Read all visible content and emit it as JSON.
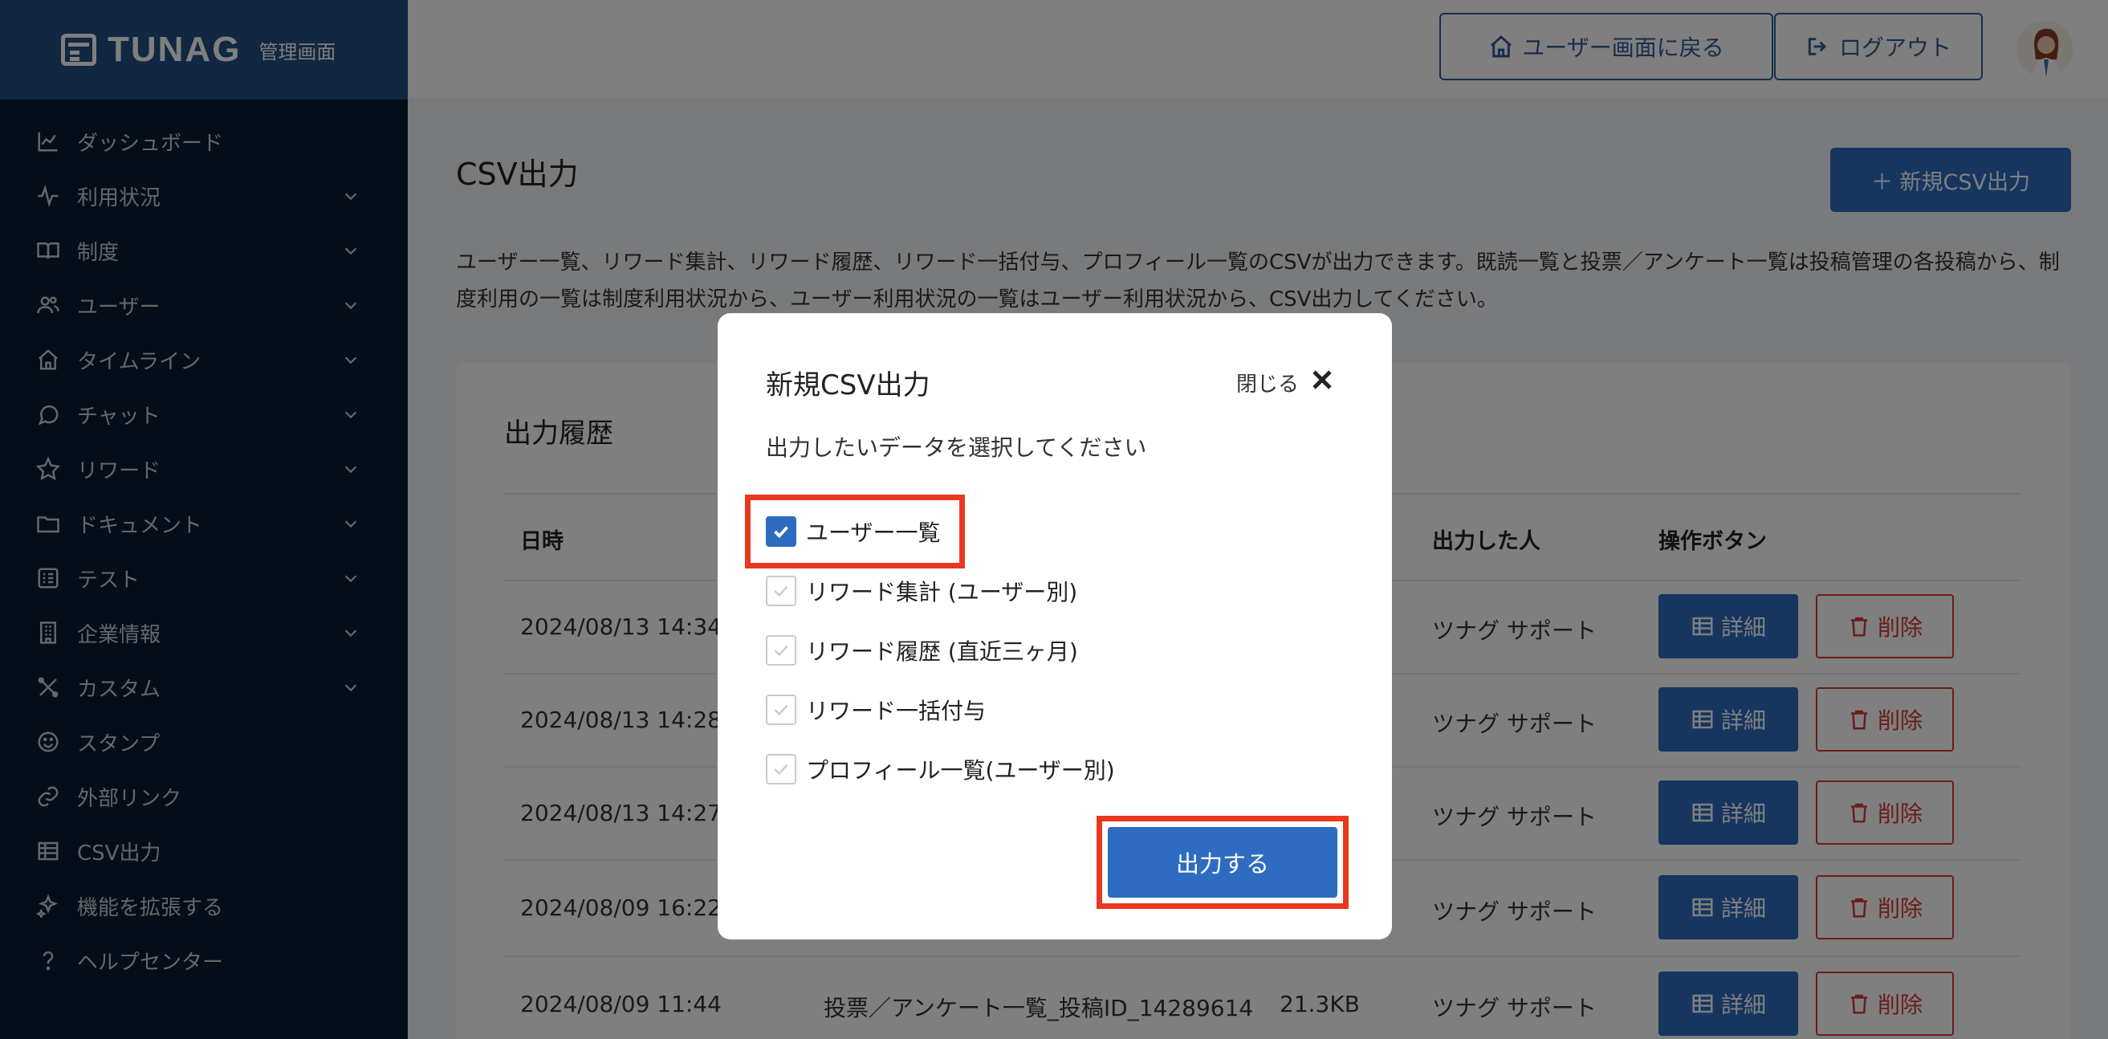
{
  "brand": {
    "name": "TUNAG",
    "sub": "管理画面"
  },
  "sidebar": {
    "items": [
      {
        "label": "ダッシュボード",
        "icon": "chart-line-icon",
        "expandable": false
      },
      {
        "label": "利用状況",
        "icon": "pulse-icon",
        "expandable": true
      },
      {
        "label": "制度",
        "icon": "book-icon",
        "expandable": true
      },
      {
        "label": "ユーザー",
        "icon": "users-icon",
        "expandable": true
      },
      {
        "label": "タイムライン",
        "icon": "home-icon",
        "expandable": true
      },
      {
        "label": "チャット",
        "icon": "chat-bubble-icon",
        "expandable": true
      },
      {
        "label": "リワード",
        "icon": "star-icon",
        "expandable": true
      },
      {
        "label": "ドキュメント",
        "icon": "folder-icon",
        "expandable": true
      },
      {
        "label": "テスト",
        "icon": "checklist-icon",
        "expandable": true
      },
      {
        "label": "企業情報",
        "icon": "building-icon",
        "expandable": true
      },
      {
        "label": "カスタム",
        "icon": "tools-icon",
        "expandable": true
      },
      {
        "label": "スタンプ",
        "icon": "smile-icon",
        "expandable": false
      },
      {
        "label": "外部リンク",
        "icon": "link-icon",
        "expandable": false
      },
      {
        "label": "CSV出力",
        "icon": "table-icon",
        "expandable": false
      },
      {
        "label": "機能を拡張する",
        "icon": "sparkle-icon",
        "expandable": false
      },
      {
        "label": "ヘルプセンター",
        "icon": "question-icon",
        "expandable": false
      }
    ]
  },
  "header": {
    "back_label": "ユーザー画面に戻る",
    "logout_label": "ログアウト"
  },
  "page": {
    "title": "CSV出力",
    "new_button": "＋ 新規CSV出力",
    "description": "ユーザー一覧、リワード集計、リワード履歴、リワード一括付与、プロフィール一覧のCSVが出力できます。既読一覧と投票／アンケート一覧は投稿管理の各投稿から、制度利用の一覧は制度利用状況から、ユーザー利用状況の一覧はユーザー利用状況から、CSV出力してください。",
    "history_title": "出力履歴"
  },
  "table": {
    "headers": {
      "date": "日時",
      "person": "出力した人",
      "actions": "操作ボタン"
    },
    "detail_label": "詳細",
    "delete_label": "削除",
    "rows": [
      {
        "date": "2024/08/13 14:34",
        "name": "",
        "size": "",
        "person": "ツナグ サポート"
      },
      {
        "date": "2024/08/13 14:28",
        "name": "",
        "size": "",
        "person": "ツナグ サポート"
      },
      {
        "date": "2024/08/13 14:27",
        "name": "",
        "size": "",
        "person": "ツナグ サポート"
      },
      {
        "date": "2024/08/09 16:22",
        "name": "",
        "size": "",
        "person": "ツナグ サポート"
      },
      {
        "date": "2024/08/09 11:44",
        "name": "投票／アンケート一覧_投稿ID_14289614",
        "size": "21.3KB",
        "person": "ツナグ サポート"
      }
    ]
  },
  "modal": {
    "title": "新規CSV出力",
    "close_label": "閉じる",
    "instruction": "出力したいデータを選択してください",
    "options": [
      {
        "label": "ユーザー一覧",
        "checked": true
      },
      {
        "label": "リワード集計 (ユーザー別)",
        "checked": false
      },
      {
        "label": "リワード履歴 (直近三ヶ月)",
        "checked": false
      },
      {
        "label": "リワード一括付与",
        "checked": false
      },
      {
        "label": "プロフィール一覧(ユーザー別)",
        "checked": false
      }
    ],
    "submit_label": "出力する"
  },
  "colors": {
    "accent": "#2d6cc0",
    "sidebar_bg": "#0a1a30",
    "brand_bg": "#234e84",
    "danger": "#d63a32",
    "highlight": "#e9381f"
  }
}
